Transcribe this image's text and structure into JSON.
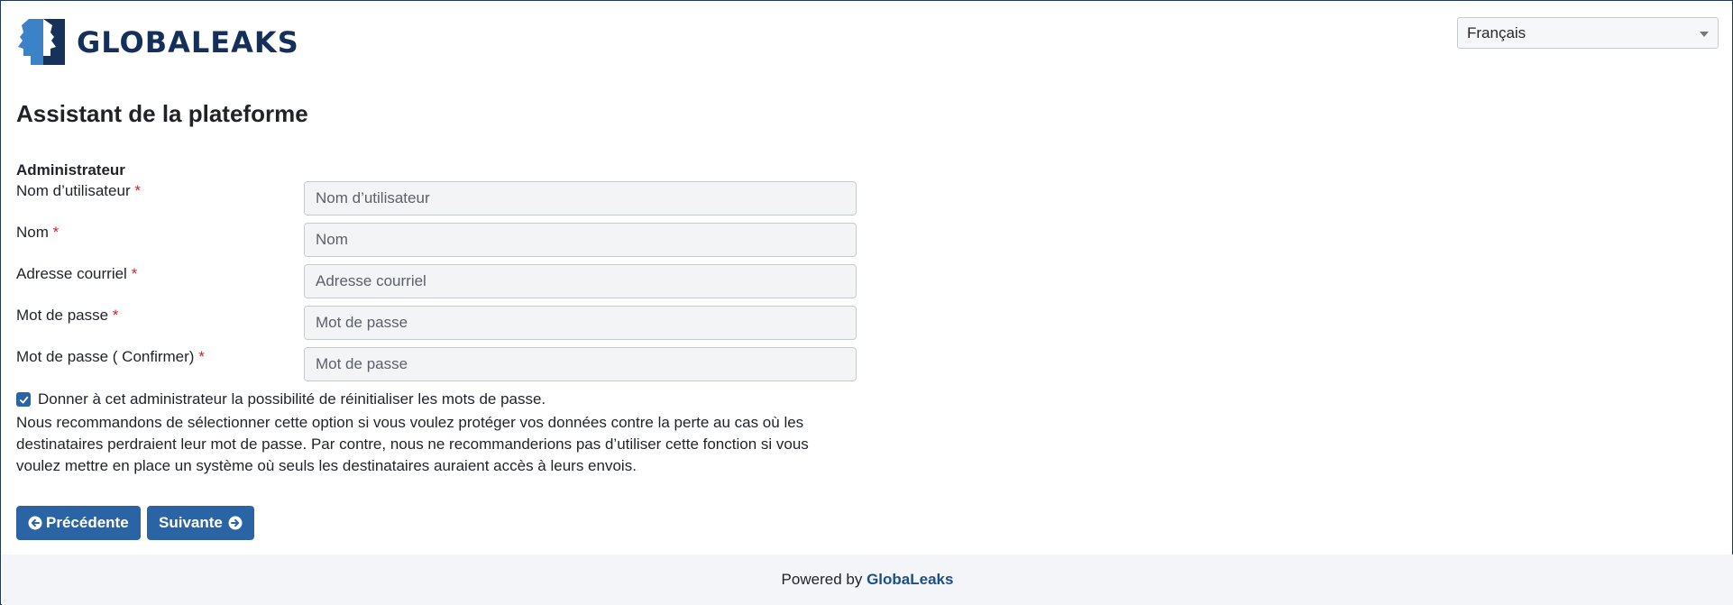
{
  "logo": {
    "text": "GLOBALEAKS",
    "icon": "globaleaks-logo-icon"
  },
  "language_select": {
    "value": "Français",
    "icon": "caret-down-icon"
  },
  "page_title": "Assistant de la plateforme",
  "section_label": "Administrateur",
  "required_marker": "*",
  "fields": [
    {
      "label": "Nom d’utilisateur",
      "placeholder": "Nom d’utilisateur"
    },
    {
      "label": "Nom",
      "placeholder": "Nom"
    },
    {
      "label": "Adresse courriel",
      "placeholder": "Adresse courriel"
    },
    {
      "label": "Mot de passe",
      "placeholder": "Mot de passe"
    },
    {
      "label": "Mot de passe ( Confirmer)",
      "placeholder": "Mot de passe"
    }
  ],
  "reset_option": {
    "checked": true,
    "label": "Donner à cet administrateur la possibilité de réinitialiser les mots de passe.",
    "help": "Nous recommandons de sélectionner cette option si vous voulez protéger vos données contre la perte au cas où les destinataires perdraient leur mot de passe. Par contre, nous ne recommanderions pas d’utiliser cette fonction si vous voulez mettre en place un système où seuls les destinataires auraient accès à leurs envois."
  },
  "buttons": {
    "previous": {
      "label": "Précédente",
      "icon": "arrow-circle-left-icon"
    },
    "next": {
      "label": "Suivante",
      "icon": "arrow-circle-right-icon"
    }
  },
  "footer": {
    "prefix": "Powered by",
    "brand": "GlobaLeaks"
  },
  "colors": {
    "primary": "#2b64a4",
    "logo_text": "#14305a",
    "required": "#d22027",
    "footer_bg": "#f4f5f8"
  }
}
